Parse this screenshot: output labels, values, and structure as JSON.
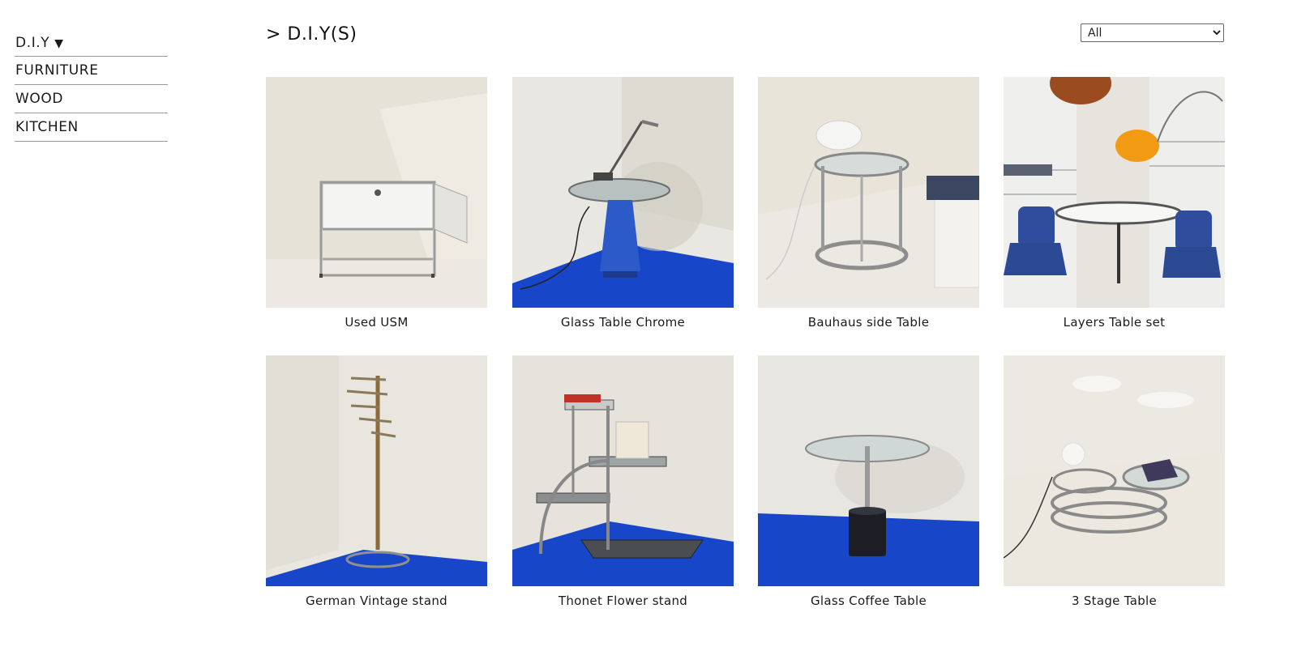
{
  "sidebar": {
    "items": [
      {
        "label": "D.I.Y",
        "expanded": true
      },
      {
        "label": "FURNITURE"
      },
      {
        "label": "WOOD"
      },
      {
        "label": "KITCHEN"
      }
    ],
    "caret_icon": "triangle-down-icon"
  },
  "header": {
    "title": "> D.I.Y(S)",
    "filter": {
      "selected": "All",
      "options": [
        "All"
      ]
    }
  },
  "products": [
    {
      "name": "Used USM"
    },
    {
      "name": "Glass Table Chrome"
    },
    {
      "name": "Bauhaus side Table"
    },
    {
      "name": "Layers Table set"
    },
    {
      "name": "German Vintage stand"
    },
    {
      "name": "Thonet Flower stand"
    },
    {
      "name": "Glass Coffee Table"
    },
    {
      "name": "3 Stage Table"
    }
  ],
  "colors": {
    "accent_blue": "#1747c8",
    "wall": "#e8e4da",
    "floor": "#efece6"
  }
}
